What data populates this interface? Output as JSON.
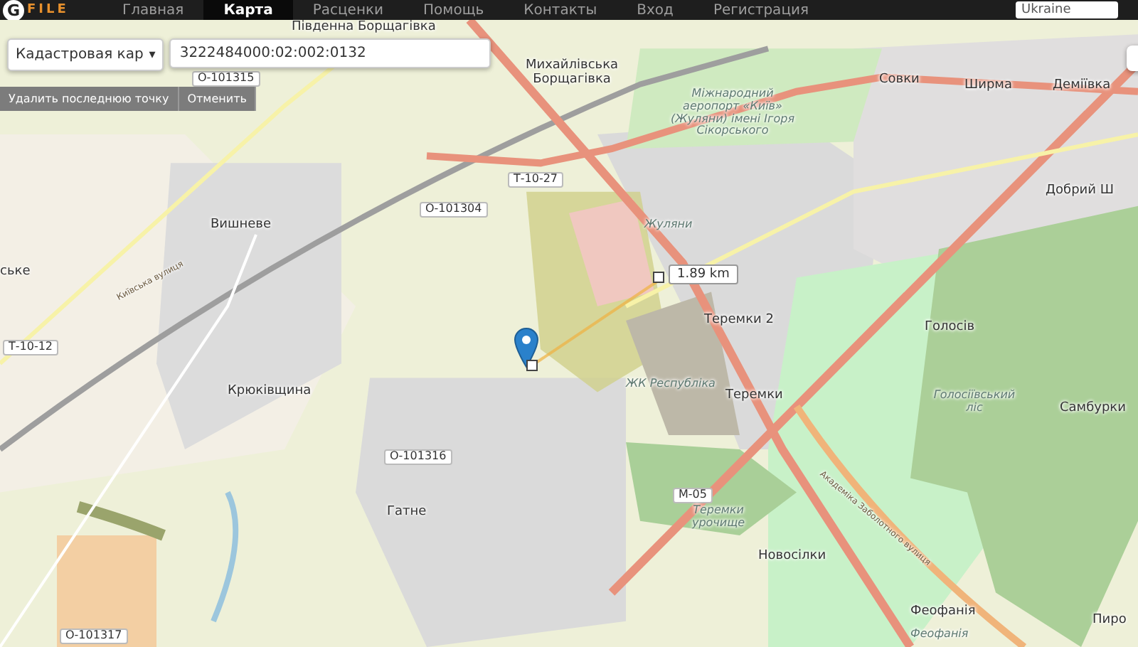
{
  "nav": {
    "logo_mark": "G",
    "logo_text": "FILE",
    "country": "Ukraine",
    "items": [
      {
        "label": "Главная",
        "selected": false
      },
      {
        "label": "Карта",
        "selected": true
      },
      {
        "label": "Расценки",
        "selected": false
      },
      {
        "label": "Помощь",
        "selected": false
      },
      {
        "label": "Контакты",
        "selected": false
      },
      {
        "label": "Вход",
        "selected": false
      },
      {
        "label": "Регистрация",
        "selected": false
      }
    ]
  },
  "search": {
    "layer": "Кадастровая кар",
    "caret": "▾",
    "number": "3222484000:02:002:0132"
  },
  "buttons": [
    "Удалить последнюю точку",
    "Отменить"
  ],
  "measure": {
    "distance": "1.89 km"
  },
  "places": [
    {
      "kind": "town",
      "text": "Південна Борщагівка"
    },
    {
      "kind": "shield",
      "text": "О-101315"
    },
    {
      "kind": "town",
      "text": "Михайлівська Борщагівка"
    },
    {
      "kind": "area",
      "text": "Міжнародний аеропорт «Київ» (Жуляни) імені Ігоря Сікорського"
    },
    {
      "kind": "town",
      "text": "Совки"
    },
    {
      "kind": "town",
      "text": "Ширма"
    },
    {
      "kind": "town",
      "text": "Деміївка"
    },
    {
      "kind": "shield",
      "text": "Т-10-27"
    },
    {
      "kind": "town",
      "text": "Вишневе"
    },
    {
      "kind": "shield",
      "text": "О-101304"
    },
    {
      "kind": "area",
      "text": "Жуляни"
    },
    {
      "kind": "town",
      "text": "Добрий Ш"
    },
    {
      "kind": "town",
      "text": "ське"
    },
    {
      "kind": "street",
      "text": "Київська вулиця"
    },
    {
      "kind": "shield",
      "text": "Т-10-12"
    },
    {
      "kind": "town",
      "text": "Теремки 2"
    },
    {
      "kind": "town",
      "text": "Голосів"
    },
    {
      "kind": "town",
      "text": "Крюківщина"
    },
    {
      "kind": "area",
      "text": "ЖК Республіка"
    },
    {
      "kind": "town",
      "text": "Теремки"
    },
    {
      "kind": "area",
      "text": "Голосіївський ліс"
    },
    {
      "kind": "town",
      "text": "Самбурки"
    },
    {
      "kind": "shield",
      "text": "О-101316"
    },
    {
      "kind": "town",
      "text": "Гатне"
    },
    {
      "kind": "shield",
      "text": "М-05"
    },
    {
      "kind": "area",
      "text": "Теремки урочище"
    },
    {
      "kind": "town",
      "text": "Новосілки"
    },
    {
      "kind": "street",
      "text": "Академіка Заболотного вулиця"
    },
    {
      "kind": "town",
      "text": "Феофанія"
    },
    {
      "kind": "area",
      "text": "Феофанія"
    },
    {
      "kind": "town",
      "text": "Пиро"
    },
    {
      "kind": "shield",
      "text": "О-101317"
    }
  ]
}
